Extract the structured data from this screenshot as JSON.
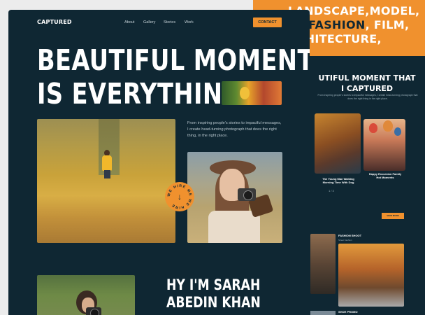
{
  "front": {
    "logo": "CAPTURED",
    "nav": [
      "About",
      "Gallery",
      "Stories",
      "Work"
    ],
    "contact_label": "CONTACT",
    "headline": [
      "BEAUTIFUL MOMENT",
      "IS EVERYTHING"
    ],
    "intro": "From inspiring people's stories to impactful messages, I create head-turning photograph that does the right thing, in the right place.",
    "badge_text": "WE HIRE ME WE HIRE",
    "badge_arrow": "↓",
    "about_title": [
      "HY I'M SARAH",
      "ABEDIN KHAN"
    ]
  },
  "back": {
    "hero_lines": [
      "LANDSCAPE,MODEL,",
      "CT FASHION, FILM,",
      "RCHITECTURE,"
    ],
    "hero_highlight": "FASHION",
    "title": [
      "UTIFUL MOMENT THAT",
      "I CAPTURED"
    ],
    "subtitle": "From inspiring people's stories to impactful messages, I create head-turning photograph that does the right thing in the right place.",
    "card_captions": [
      "The Young Man Walking Morning Time With Dog",
      "Happy Excursion Family Hot Moments"
    ],
    "pager": "1 / 3",
    "more_label": "VIEW MORE",
    "fashion_label": "FASHION SHOOT",
    "fashion_sub": "Street Fashion",
    "promo_label": "SHOE PROMO"
  },
  "colors": {
    "accent": "#f0912e",
    "background": "#0f2733",
    "text": "#ffffff"
  }
}
